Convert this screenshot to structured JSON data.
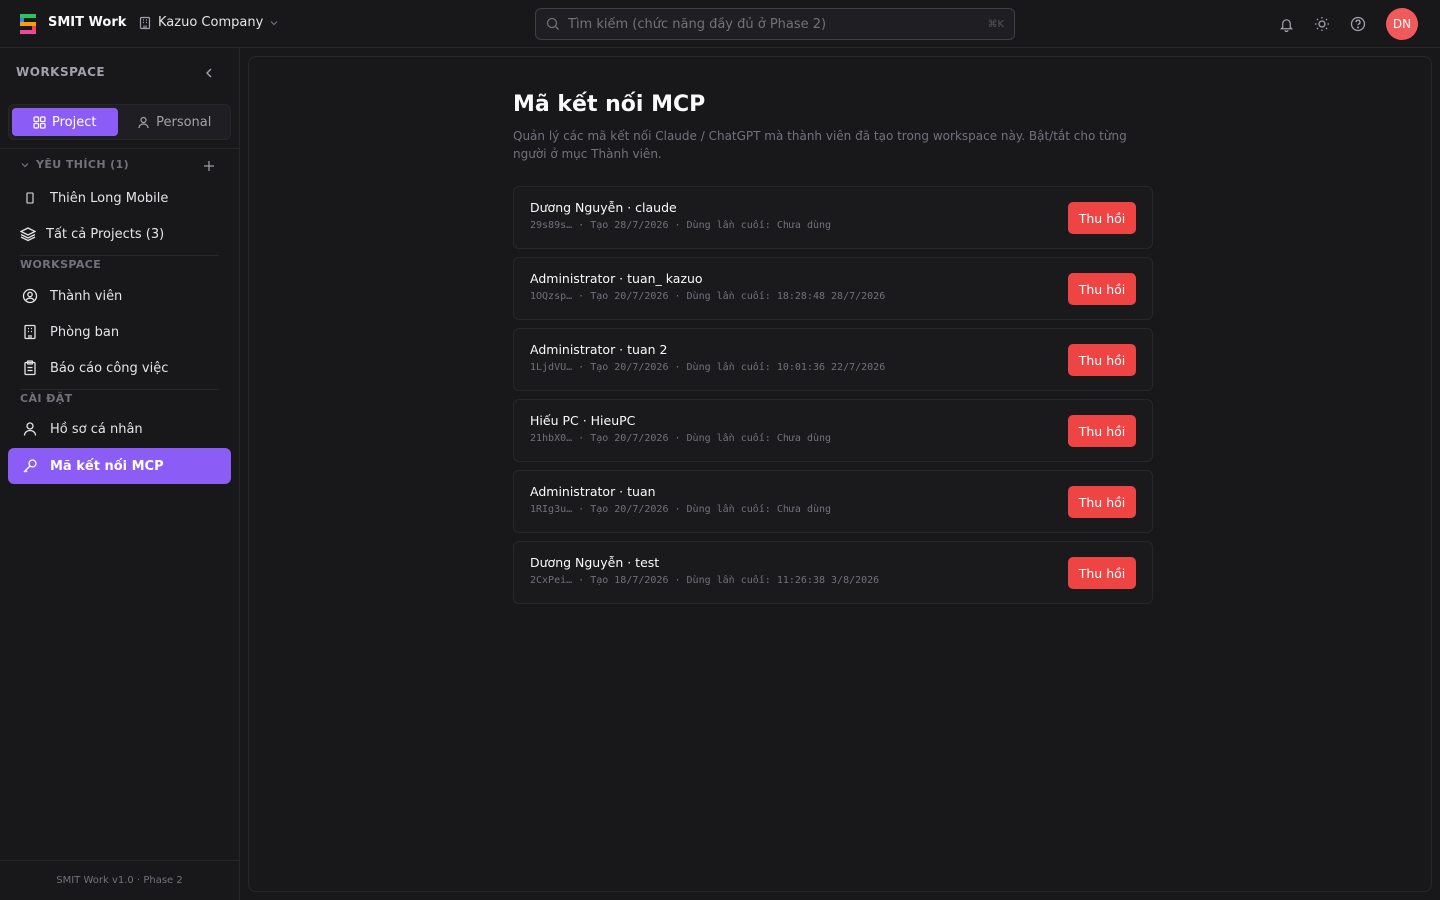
{
  "app": {
    "name": "SMIT Work",
    "company": "Kazuo Company",
    "search_placeholder": "Tìm kiếm (chức năng đầy đủ ở Phase 2)",
    "search_shortcut": "⌘K",
    "user_initials": "DN"
  },
  "sidebar": {
    "title": "WORKSPACE",
    "tabs": [
      {
        "label": "Project",
        "active": true
      },
      {
        "label": "Personal",
        "active": false
      }
    ],
    "favorites_header": "YÊU THÍCH (1)",
    "favorites": [
      {
        "label": "Thiên Long Mobile"
      },
      {
        "label": "Tất cả Projects (3)"
      }
    ],
    "workspace_section": "WORKSPACE",
    "workspace_items": [
      {
        "label": "Thành viên"
      },
      {
        "label": "Phòng ban"
      },
      {
        "label": "Báo cáo công việc"
      }
    ],
    "settings_section": "CÀI ĐẶT",
    "settings_items": [
      {
        "label": "Hồ sơ cá nhân",
        "active": false
      },
      {
        "label": "Mã kết nối MCP",
        "active": true
      }
    ],
    "footer": "SMIT Work v1.0 · Phase 2"
  },
  "main": {
    "title": "Mã kết nối MCP",
    "description": "Quản lý các mã kết nối Claude / ChatGPT mà thành viên đã tạo trong workspace này. Bật/tắt cho từng người ở mục Thành viên.",
    "revoke_label": "Thu hồi",
    "tokens": [
      {
        "title": "Dương Nguyễn · claude",
        "meta": "29s89s… · Tạo 28/7/2026 · Dùng lần cuối: Chưa dùng"
      },
      {
        "title": "Administrator · tuan_ kazuo",
        "meta": "1OQzsp… · Tạo 20/7/2026 · Dùng lần cuối: 18:28:48 28/7/2026"
      },
      {
        "title": "Administrator · tuan 2",
        "meta": "1LjdVU… · Tạo 20/7/2026 · Dùng lần cuối: 10:01:36 22/7/2026"
      },
      {
        "title": "Hiếu PC · HieuPC",
        "meta": "21hbX0… · Tạo 20/7/2026 · Dùng lần cuối: Chưa dùng"
      },
      {
        "title": "Administrator · tuan",
        "meta": "1RIg3u… · Tạo 20/7/2026 · Dùng lần cuối: Chưa dùng"
      },
      {
        "title": "Dương Nguyễn · test",
        "meta": "2CxPei… · Tạo 18/7/2026 · Dùng lần cuối: 11:26:38 3/8/2026"
      }
    ]
  },
  "colors": {
    "accent": "#8b5cf6",
    "danger": "#ef4444",
    "avatar": "#f05a5a",
    "background": "#18181b"
  }
}
